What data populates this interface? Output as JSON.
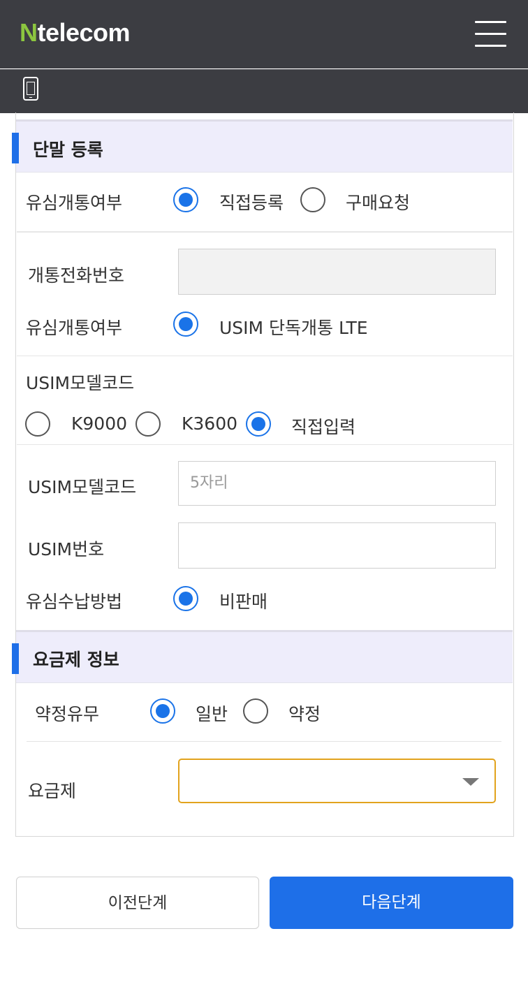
{
  "header": {
    "logo_mark": "N",
    "logo_text": "telecom",
    "menu_icon": "hamburger-icon",
    "device_icon": "phone-icon"
  },
  "device_section": {
    "title": "단말 등록",
    "usim_activation": {
      "label": "유심개통여부",
      "options": [
        {
          "label": "직접등록",
          "selected": true
        },
        {
          "label": "구매요청",
          "selected": false
        }
      ]
    },
    "phone_number": {
      "label": "개통전화번호",
      "value": "",
      "placeholder": ""
    },
    "usim_activation_type": {
      "label": "유심개통여부",
      "option": "USIM 단독개통 LTE",
      "selected": true
    },
    "model_code_choice": {
      "label": "USIM모델코드",
      "options": [
        {
          "label": "K9000",
          "selected": false
        },
        {
          "label": "K3600",
          "selected": false
        },
        {
          "label": "직접입력",
          "selected": true
        }
      ]
    },
    "model_code_input": {
      "label": "USIM모델코드",
      "placeholder": "5자리",
      "value": ""
    },
    "usim_number": {
      "label": "USIM번호",
      "value": "",
      "placeholder": ""
    },
    "usim_payment": {
      "label": "유심수납방법",
      "option": "비판매",
      "selected": true
    }
  },
  "plan_section": {
    "title": "요금제 정보",
    "contract": {
      "label": "약정유무",
      "options": [
        {
          "label": "일반",
          "selected": true
        },
        {
          "label": "약정",
          "selected": false
        }
      ]
    },
    "plan": {
      "label": "요금제",
      "selected_value": ""
    }
  },
  "actions": {
    "prev_label": "이전단계",
    "next_label": "다음단계"
  },
  "colors": {
    "header_bg": "#3c3d42",
    "accent_blue": "#1e6fe8",
    "logo_green": "#8cc63f",
    "select_border": "#e2a31d",
    "section_bg": "#eeedfb"
  }
}
